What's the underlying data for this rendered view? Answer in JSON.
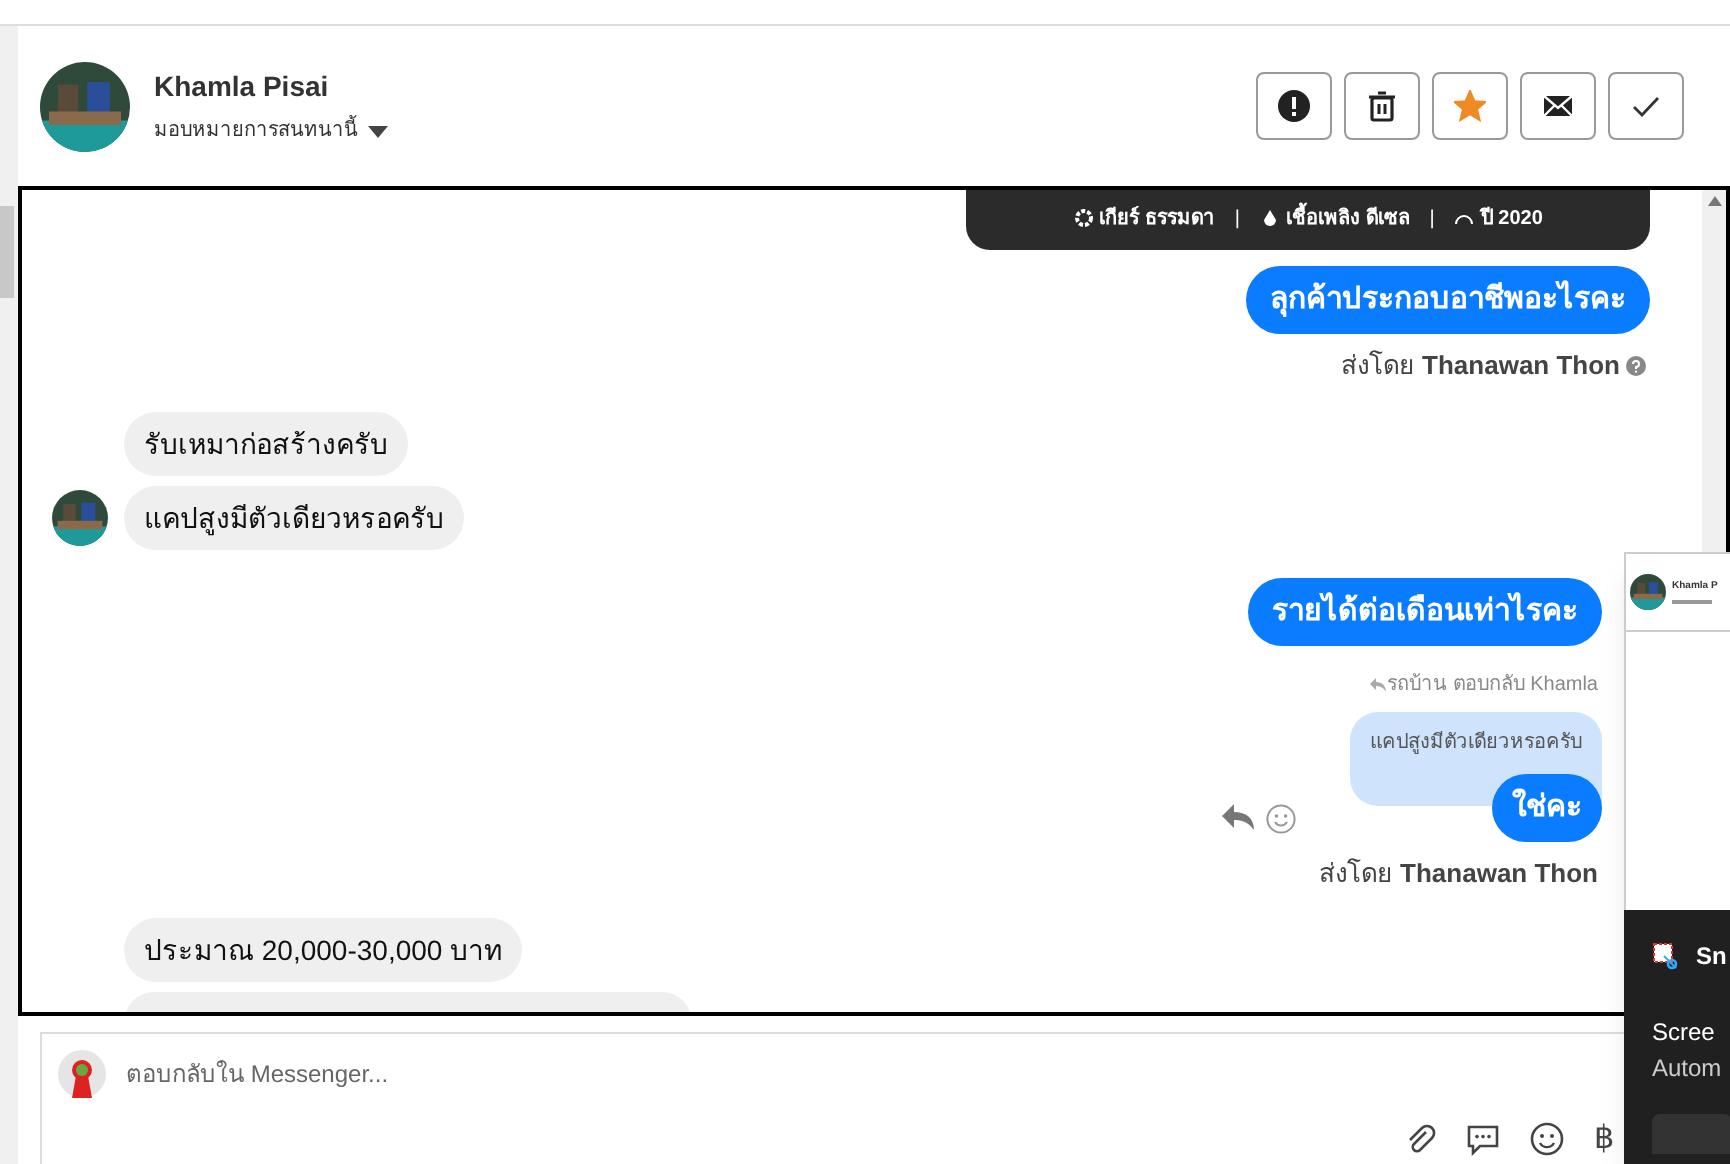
{
  "header": {
    "name": "Khamla Pisai",
    "assign_label": "มอบหมายการสนทนานี้",
    "actions": [
      {
        "kind": "alert"
      },
      {
        "kind": "delete"
      },
      {
        "kind": "star",
        "on": true
      },
      {
        "kind": "mail"
      },
      {
        "kind": "done"
      }
    ]
  },
  "messages": [
    {
      "kind": "car_card",
      "specs": [
        "เกียร์ ธรรมดา",
        "เชื้อเพลิง ดีเซล",
        "ปี 2020"
      ],
      "separator": "|"
    },
    {
      "kind": "outgoing",
      "text": "ลุกค้าประกอบอาชีพอะไรคะ"
    },
    {
      "kind": "sent_by",
      "text": "ส่งโดย **Thanawan Thon**"
    },
    {
      "kind": "incoming",
      "text": "รับเหมาก่อสร้างครับ",
      "avatar": false
    },
    {
      "kind": "incoming",
      "text": "แคปสูงมีตัวเดียวหรอครับ",
      "avatar": true
    },
    {
      "kind": "outgoing",
      "text": "รายได้ต่อเดือนเท่าไรคะ"
    },
    {
      "kind": "reply_quote",
      "label": "รถบ้าน ตอบกลับ Khamla",
      "quoted": "แคปสูงมีตัวเดียวหรอครับ",
      "text": "ใช่คะ"
    },
    {
      "kind": "sent_by",
      "text": "ส่งโดย **Thanawan Thon**"
    },
    {
      "kind": "incoming",
      "text": "ประมาณ 20,000-30,000 บาท",
      "avatar": false
    },
    {
      "kind": "incoming_cut"
    }
  ],
  "composer": {
    "placeholder": "ตอบกลับใน Messenger...",
    "currency": "฿"
  },
  "popup": {
    "name": "Khamla P",
    "app": "Sn",
    "lines": [
      "Scree",
      "Autom"
    ]
  }
}
